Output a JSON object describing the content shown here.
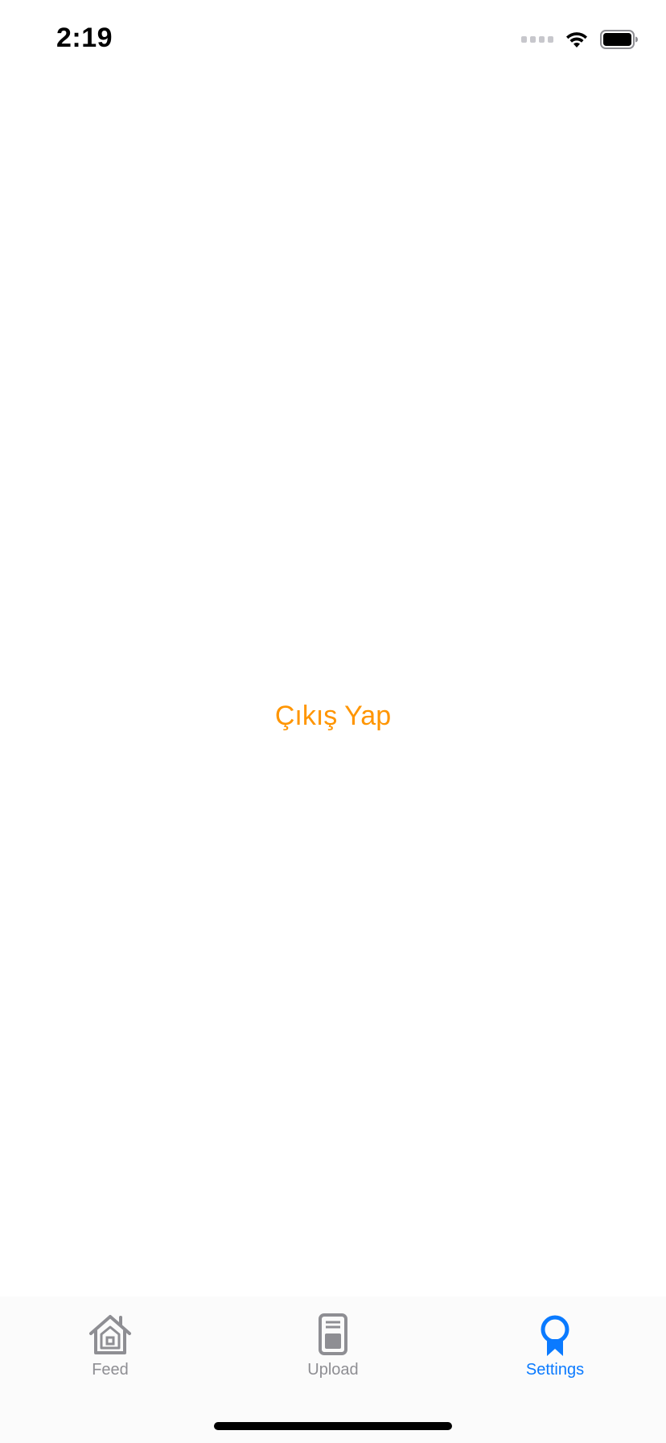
{
  "status_bar": {
    "time": "2:19",
    "icons": [
      "cellular-signal-icon",
      "wifi-icon",
      "battery-icon"
    ]
  },
  "main": {
    "logout_label": "Çıkış Yap",
    "logout_color": "#ff9500"
  },
  "tab_bar": {
    "active_color": "#0a7aff",
    "inactive_color": "#8e8e93",
    "tabs": [
      {
        "label": "Feed",
        "icon": "house-icon",
        "active": false
      },
      {
        "label": "Upload",
        "icon": "document-icon",
        "active": false
      },
      {
        "label": "Settings",
        "icon": "rosette-icon",
        "active": true
      }
    ]
  }
}
